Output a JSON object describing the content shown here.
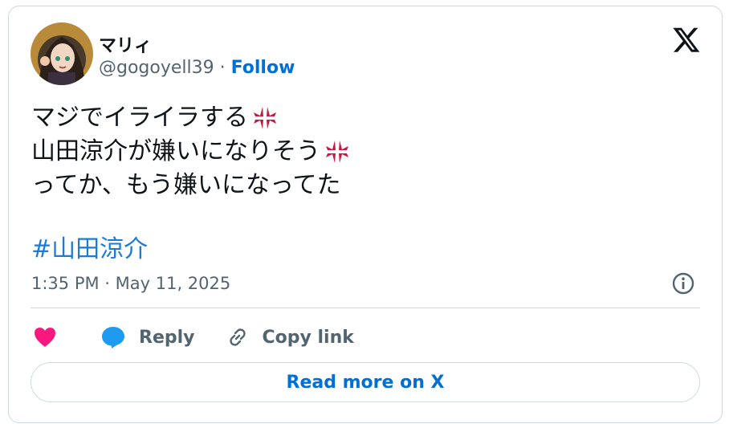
{
  "author": {
    "name": "マリィ",
    "handle": "@gogoyell39",
    "separator": "·",
    "follow_label": "Follow",
    "avatar_icon": "avatar-illustration"
  },
  "brand": {
    "logo_icon": "x-logo-icon"
  },
  "tweet": {
    "lines": [
      "マジでイライラする",
      "山田涼介が嫌いになりそう",
      "ってか、もう嫌いになってた"
    ],
    "line_emoji": [
      "anger-icon",
      "anger-icon",
      ""
    ],
    "hashtag": "#山田涼介",
    "timestamp": "1:35 PM · May 11, 2025"
  },
  "actions": {
    "like_icon": "heart-icon",
    "reply_label": "Reply",
    "copy_label": "Copy link"
  },
  "read_more_label": "Read more on X",
  "colors": {
    "accent": "#006fd6",
    "hashtag": "#1d7bd8",
    "like": "#f91880",
    "reply": "#1d9bf0",
    "anger": "#c61b3f",
    "muted": "#536471",
    "border": "#cfd9de"
  }
}
